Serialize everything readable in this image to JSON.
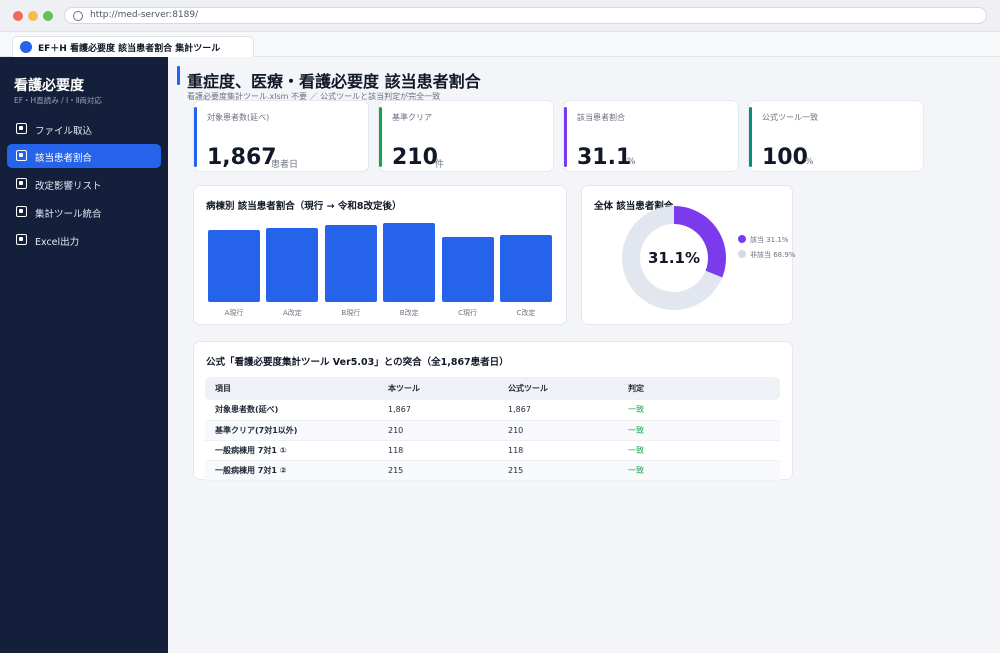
{
  "browser": {
    "url": "http://med-server:8189/",
    "tab_title": "EF＋H 看護必要度 該当患者割合 集計ツール"
  },
  "sidebar": {
    "title": "看護必要度",
    "subtitle": "EF・H直読み / Ⅰ・Ⅱ両対応",
    "items": [
      {
        "label": "ファイル取込",
        "active": false
      },
      {
        "label": "該当患者割合",
        "active": true
      },
      {
        "label": "改定影響リスト",
        "active": false
      },
      {
        "label": "集計ツール統合",
        "active": false
      },
      {
        "label": "Excel出力",
        "active": false
      }
    ]
  },
  "header": {
    "title": "重症度、医療・看護必要度 該当患者割合",
    "subtitle": "看護必要度集計ツール.xlsm 不要 ／ 公式ツールと該当判定が完全一致"
  },
  "kpis": [
    {
      "label": "対象患者数(延べ)",
      "value": "1,867",
      "unit": "患者日",
      "color": "#2563eb"
    },
    {
      "label": "基準クリア",
      "value": "210",
      "unit": "件",
      "color": "#16a34a"
    },
    {
      "label": "該当患者割合",
      "value": "31.1",
      "unit": "%",
      "color": "#7c3aed"
    },
    {
      "label": "公式ツール一致",
      "value": "100",
      "unit": "%",
      "color": "#0f8a7e"
    }
  ],
  "bar_card": {
    "title": "病棟別 該当患者割合（現行 → 令和8改定後）"
  },
  "donut_card": {
    "title": "全体 該当患者割合",
    "center_label": "31.1%"
  },
  "chart_data": [
    {
      "type": "bar",
      "title": "病棟別 該当患者割合（現行 → 令和8改定後）",
      "categories": [
        "A現行",
        "A改定",
        "B現行",
        "B改定",
        "C現行",
        "C改定"
      ],
      "values": [
        72,
        74,
        77,
        79,
        65,
        67
      ],
      "xlabel": "",
      "ylabel": "",
      "ylim": [
        0,
        80
      ],
      "grid": false,
      "color": "#2563eb"
    },
    {
      "type": "pie",
      "title": "全体 該当患者割合",
      "labels": [
        "該当",
        "非該当"
      ],
      "values": [
        31.1,
        68.9
      ],
      "legend": [
        "該当 31.1%",
        "非該当 68.9%"
      ],
      "colors": [
        "#7c3aed",
        "#e2e6ee"
      ],
      "legend_position": "right"
    }
  ],
  "match_table": {
    "title": "公式「看護必要度集計ツール Ver5.03」との突合（全1,867患者日）",
    "headers": [
      "項目",
      "本ツール",
      "公式ツール",
      "判定"
    ],
    "rows": [
      [
        "対象患者数(延べ)",
        "1,867",
        "1,867",
        "一致"
      ],
      [
        "基準クリア(7対1以外)",
        "210",
        "210",
        "一致"
      ],
      [
        "一般病棟用 7対1 ①",
        "118",
        "118",
        "一致"
      ],
      [
        "一般病棟用 7対1 ②",
        "215",
        "215",
        "一致"
      ]
    ]
  }
}
